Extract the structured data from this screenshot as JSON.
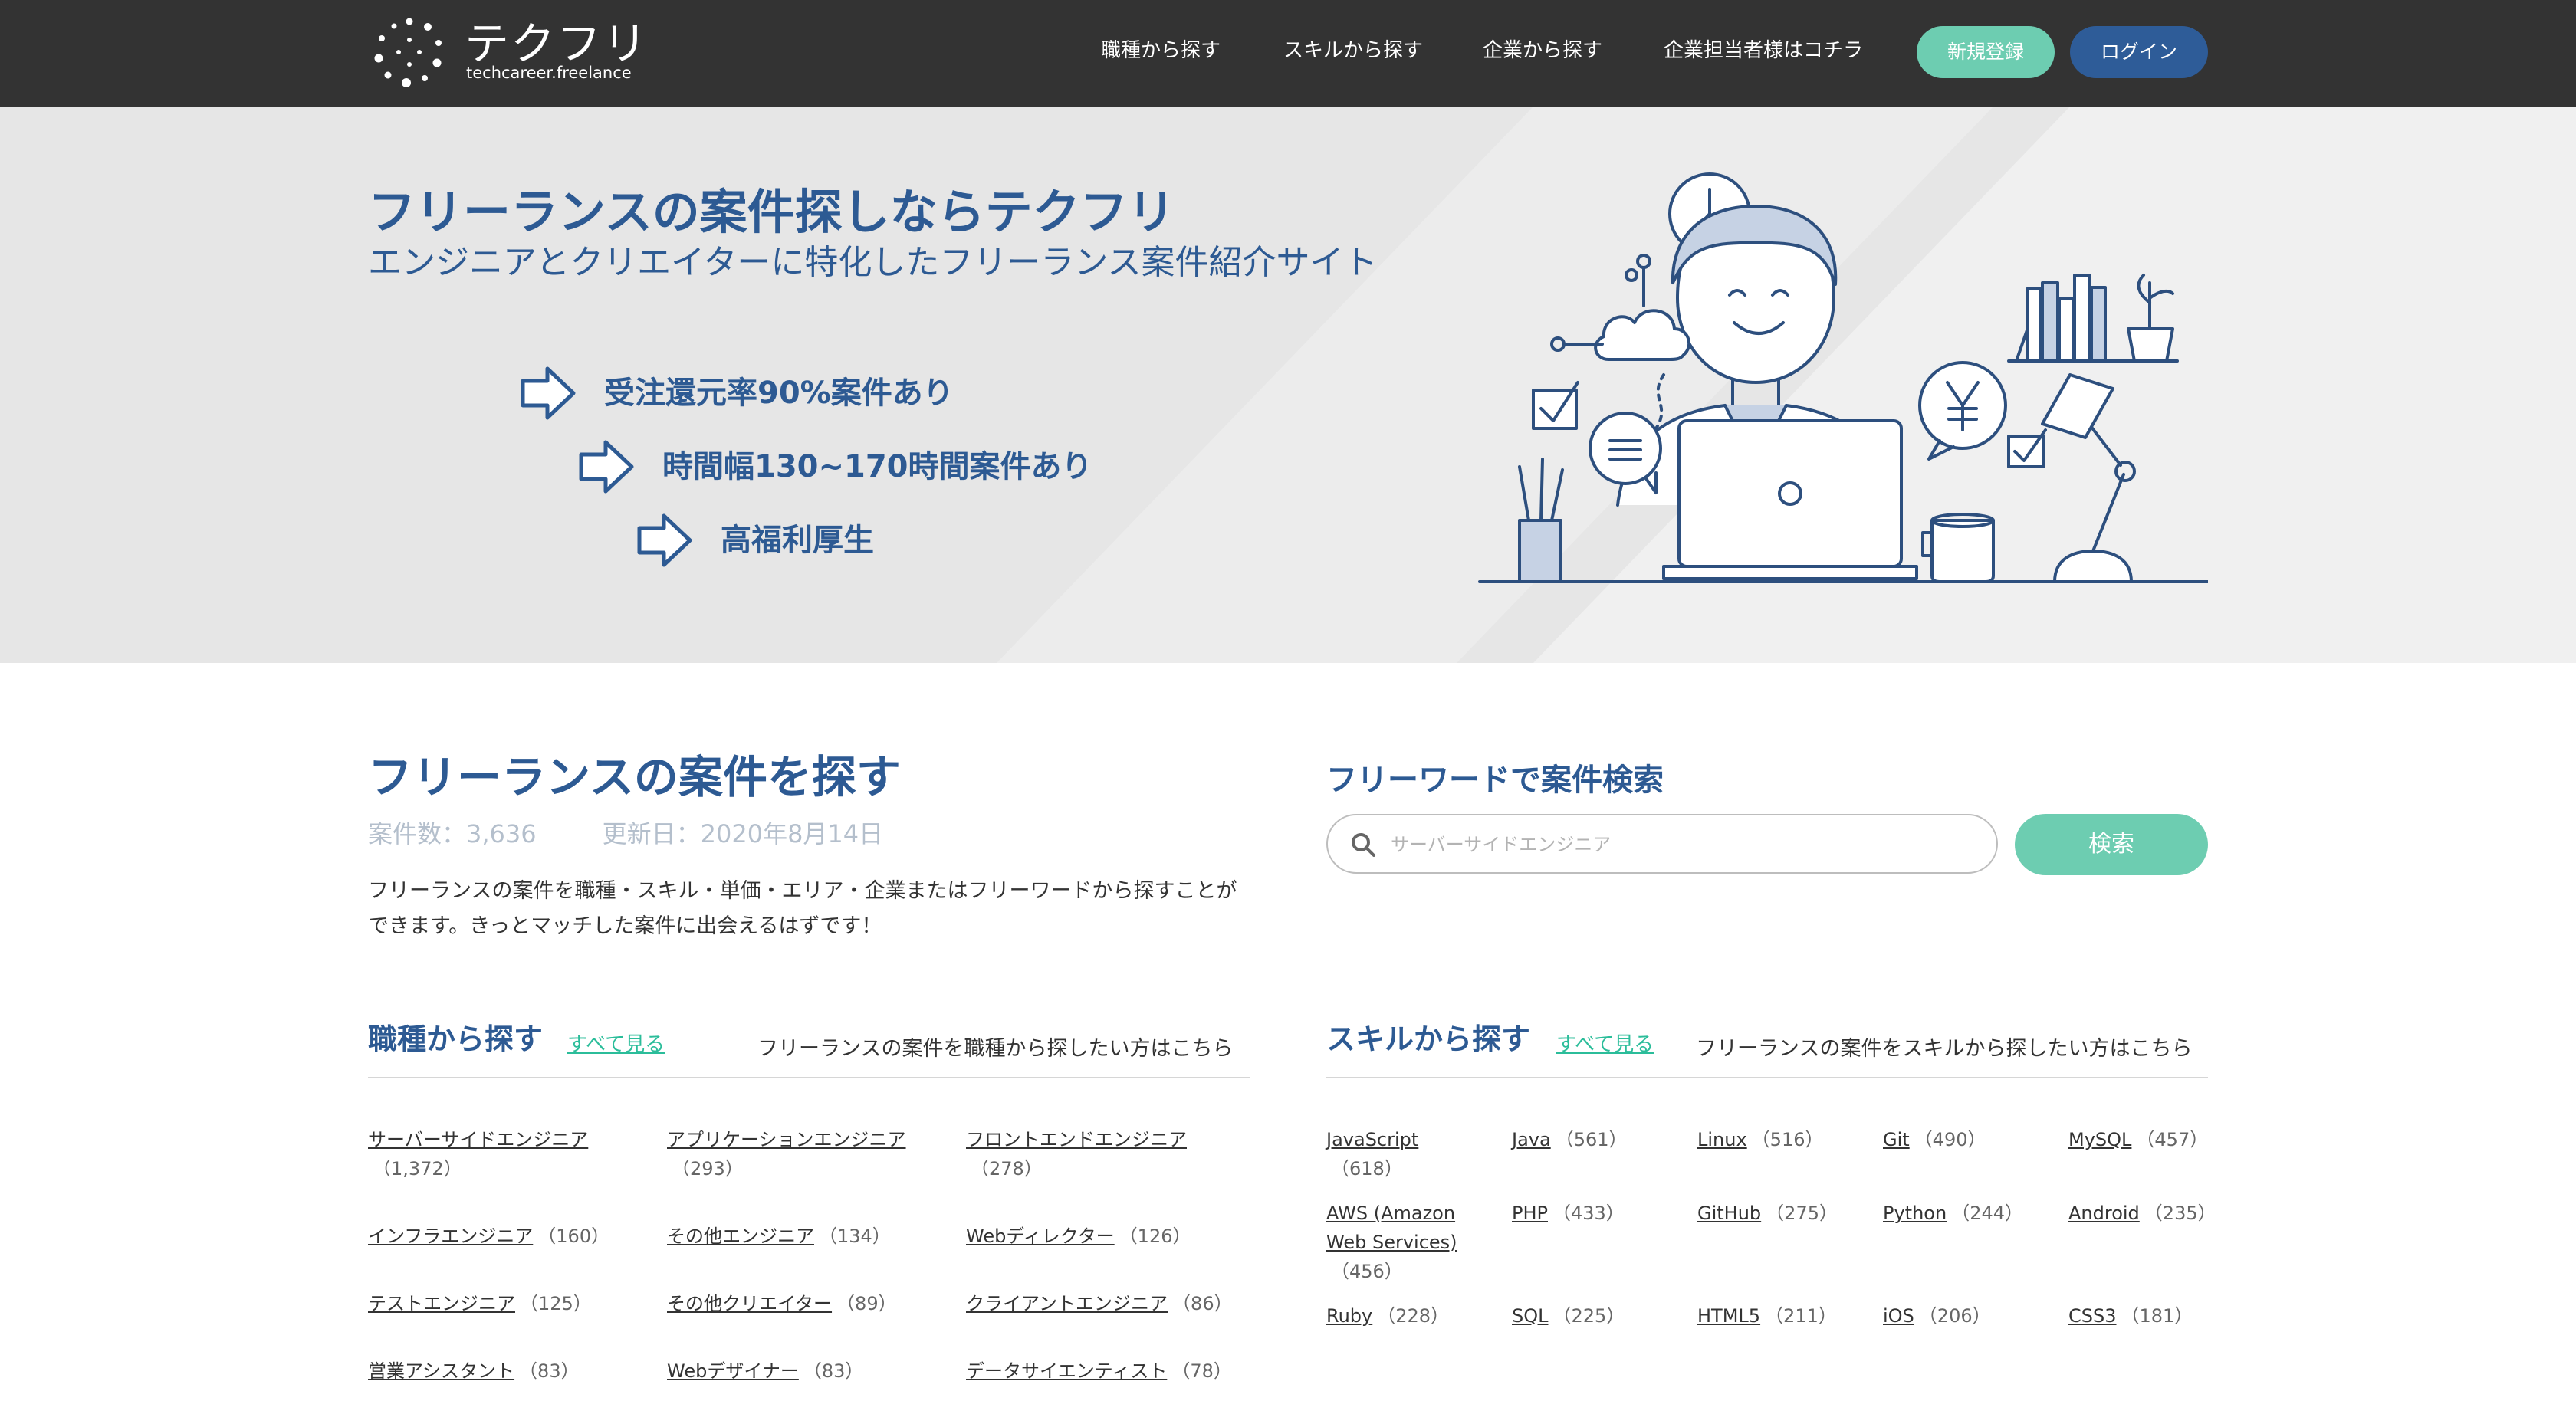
{
  "brand": {
    "name": "テクフリ",
    "sub": "techcareer.freelance"
  },
  "nav": {
    "job_type": "職種から探す",
    "skill": "スキルから探す",
    "company": "企業から探す",
    "for_companies": "企業担当者様はコチラ",
    "register": "新規登録",
    "login": "ログイン"
  },
  "hero": {
    "title": "フリーランスの案件探しならテクフリ",
    "subtitle": "エンジニアとクリエイターに特化したフリーランス案件紹介サイト",
    "features": [
      "受注還元率90%案件あり",
      "時間幅130~170時間案件あり",
      "高福利厚生"
    ]
  },
  "search_section": {
    "title": "フリーランスの案件を探す",
    "count": "案件数：3,636",
    "updated": "更新日：2020年8月14日",
    "description": "フリーランスの案件を職種・スキル・単価・エリア・企業またはフリーワードから探すことができます。きっとマッチした案件に出会えるはずです！",
    "freeword_title": "フリーワードで案件検索",
    "placeholder": "サーバーサイドエンジニア",
    "button": "検索"
  },
  "job_types": {
    "title": "職種から探す",
    "see_all": "すべて見る",
    "description": "フリーランスの案件を職種から探したい方はこちら",
    "items": [
      {
        "label": "サーバーサイドエンジニア",
        "count": "（1,372）"
      },
      {
        "label": "アプリケーションエンジニア",
        "count": "（293）"
      },
      {
        "label": "フロントエンドエンジニア",
        "count": "（278）"
      },
      {
        "label": "インフラエンジニア",
        "count": "（160）"
      },
      {
        "label": "その他エンジニア",
        "count": "（134）"
      },
      {
        "label": "Webディレクター",
        "count": "（126）"
      },
      {
        "label": "テストエンジニア",
        "count": "（125）"
      },
      {
        "label": "その他クリエイター",
        "count": "（89）"
      },
      {
        "label": "クライアントエンジニア",
        "count": "（86）"
      },
      {
        "label": "営業アシスタント",
        "count": "（83）"
      },
      {
        "label": "Webデザイナー",
        "count": "（83）"
      },
      {
        "label": "データサイエンティスト",
        "count": "（78）"
      }
    ]
  },
  "skills": {
    "title": "スキルから探す",
    "see_all": "すべて見る",
    "description": "フリーランスの案件をスキルから探したい方はこちら",
    "items": [
      {
        "label": "JavaScript",
        "count": "（618）"
      },
      {
        "label": "Java",
        "count": "（561）"
      },
      {
        "label": "Linux",
        "count": "（516）"
      },
      {
        "label": "Git",
        "count": "（490）"
      },
      {
        "label": "MySQL",
        "count": "（457）"
      },
      {
        "label": "AWS (Amazon Web Services)",
        "count": "（456）"
      },
      {
        "label": "PHP",
        "count": "（433）"
      },
      {
        "label": "GitHub",
        "count": "（275）"
      },
      {
        "label": "Python",
        "count": "（244）"
      },
      {
        "label": "Android",
        "count": "（235）"
      },
      {
        "label": "Ruby",
        "count": "（228）"
      },
      {
        "label": "SQL",
        "count": "（225）"
      },
      {
        "label": "HTML5",
        "count": "（211）"
      },
      {
        "label": "iOS",
        "count": "（206）"
      },
      {
        "label": "CSS3",
        "count": "（181）"
      }
    ]
  },
  "colors": {
    "header": "#333333",
    "brand_blue": "#2d5a93",
    "accent_green": "#6dcdb1",
    "login_blue": "#2e5c98"
  }
}
